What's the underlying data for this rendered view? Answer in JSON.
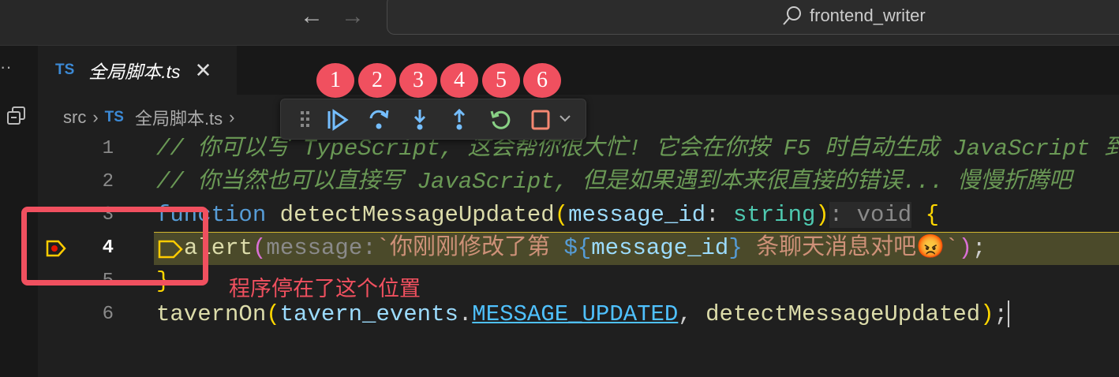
{
  "titlebar": {
    "back": "←",
    "forward": "→",
    "search_text": "frontend_writer"
  },
  "tab": {
    "lang": "TS",
    "name": "全局脚本.ts",
    "close": "✕"
  },
  "breadcrumb": {
    "folder": "src",
    "sep": "›",
    "lang": "TS",
    "file": "全局脚本.ts"
  },
  "badges": [
    "1",
    "2",
    "3",
    "4",
    "5",
    "6"
  ],
  "debug_toolbar": [
    "continue",
    "step-over",
    "step-into",
    "step-out",
    "restart",
    "stop"
  ],
  "lines": [
    {
      "n": "1",
      "comment": "// 你可以写 TypeScript, 这会帮你很大忙! 它会在你按 F5 时自动生成 JavaScript 到"
    },
    {
      "n": "2",
      "comment": "// 你当然也可以直接写 JavaScript, 但是如果遇到本来很直接的错误... 慢慢折腾吧"
    },
    {
      "n": "3",
      "kw": "function",
      "fn": "detectMessageUpdated",
      "p1": "(",
      "param": "message_id",
      "colon": ": ",
      "type": "string",
      "p2": ")",
      "hint": ": void",
      "brace": " {"
    },
    {
      "n": "4",
      "fn": "alert",
      "p1": "(",
      "hint": "message:",
      "str1": "`你刚刚修改了第 ",
      "d1": "${",
      "var": "message_id",
      "d2": "}",
      "str2": " 条聊天消息对吧😡`",
      "p2": ")",
      "semi": ";"
    },
    {
      "n": "5",
      "brace": "}"
    },
    {
      "n": "6",
      "fn": "tavernOn",
      "p1": "(",
      "obj": "tavern_events",
      "dot": ".",
      "const": "MESSAGE_UPDATED",
      "comma": ", ",
      "arg": "detectMessageUpdated",
      "p2": ")",
      "semi": ";"
    }
  ],
  "annotation": "程序停在了这个位置",
  "colors": {
    "accent": "#f0505f",
    "highlight": "#4b4a2a"
  }
}
